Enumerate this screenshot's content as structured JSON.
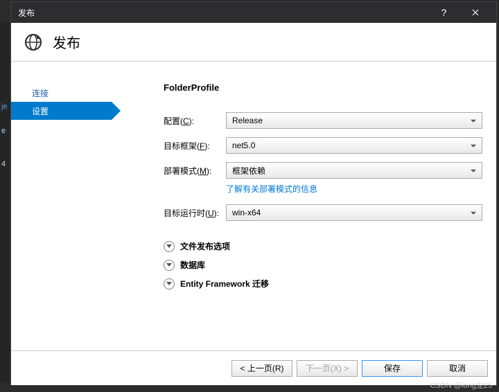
{
  "titlebar": {
    "title": "发布"
  },
  "header": {
    "title": "发布"
  },
  "sidebar": {
    "items": [
      {
        "label": "连接"
      },
      {
        "label": "设置"
      }
    ]
  },
  "main": {
    "profile_title": "FolderProfile",
    "rows": {
      "config": {
        "label_prefix": "配置(",
        "hotkey": "C",
        "label_suffix": "):",
        "value": "Release"
      },
      "framework": {
        "label_prefix": "目标框架(",
        "hotkey": "F",
        "label_suffix": "):",
        "value": "net5.0"
      },
      "deploy": {
        "label_prefix": "部署模式(",
        "hotkey": "M",
        "label_suffix": "):",
        "value": "框架依赖",
        "info": "了解有关部署模式的信息"
      },
      "runtime": {
        "label_prefix": "目标运行时(",
        "hotkey": "U",
        "label_suffix": "):",
        "value": "win-x64"
      }
    },
    "expanders": {
      "file_publish": "文件发布选项",
      "db": "数据库",
      "ef": "Entity Framework 迁移"
    }
  },
  "footer": {
    "prev": "< 上一页(R)",
    "next": "下一页(X) >",
    "save": "保存",
    "cancel": "取消"
  },
  "watermark": "CSDN @long龙25"
}
